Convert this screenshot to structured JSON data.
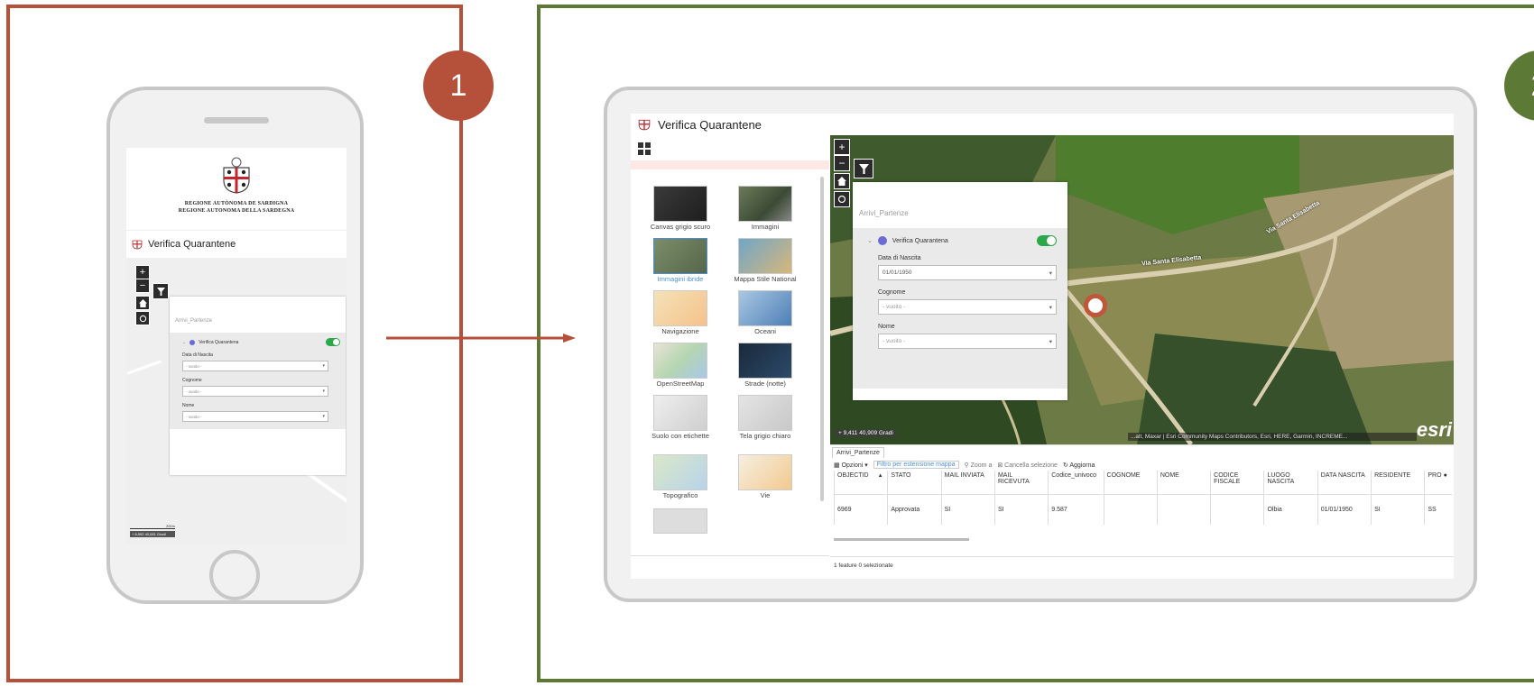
{
  "steps": [
    {
      "number": "1",
      "color": "#b5513a"
    },
    {
      "number": "2",
      "color": "#5c7a36"
    }
  ],
  "mobile": {
    "region_line_1": "REGIONE AUTÒNOMA DE SARDIGNA",
    "region_line_2": "REGIONE AUTONOMA DELLA SARDEGNA",
    "app_title": "Verifica Quarantene",
    "map_controls": {
      "zoom_in": "+",
      "zoom_out": "−"
    },
    "widget": {
      "title": "Arrivi_Partenze",
      "layer_name": "Verifica Quarantena",
      "fields": [
        {
          "label": "Data di Nascita",
          "value": "- vuoito -"
        },
        {
          "label": "Cognome",
          "value": "- vuoito -"
        },
        {
          "label": "Nome",
          "value": "- vuoito -"
        }
      ]
    },
    "scale_label": "200m",
    "coords": "+ 6,992 40,081 Gradi"
  },
  "desktop": {
    "app_title": "Verifica Quarantene",
    "basemaps": [
      {
        "label": "Canvas grigio scuro",
        "icon": "dark-gray-canvas-thumb"
      },
      {
        "label": "Immagini",
        "icon": "imagery-thumb"
      },
      {
        "label": "Immagini ibride",
        "icon": "imagery-hybrid-thumb",
        "selected": true
      },
      {
        "label": "Mappa Stile National",
        "icon": "national-geographic-thumb"
      },
      {
        "label": "Navigazione",
        "icon": "navigation-thumb"
      },
      {
        "label": "Oceani",
        "icon": "oceans-thumb"
      },
      {
        "label": "OpenStreetMap",
        "icon": "osm-thumb"
      },
      {
        "label": "Strade (notte)",
        "icon": "streets-night-thumb"
      },
      {
        "label": "Suolo con etichette",
        "icon": "terrain-thumb"
      },
      {
        "label": "Tela grigio chiaro",
        "icon": "light-gray-canvas-thumb"
      },
      {
        "label": "Topografico",
        "icon": "topographic-thumb"
      },
      {
        "label": "Vie",
        "icon": "streets-thumb"
      }
    ],
    "map_controls": {
      "zoom_in": "+",
      "zoom_out": "−"
    },
    "widget": {
      "title": "Arrivi_Partenze",
      "layer_name": "Verifica Quarantena",
      "fields": [
        {
          "label": "Data di Nascita",
          "value": "01/01/1950"
        },
        {
          "label": "Cognome",
          "value": "- vuoito -"
        },
        {
          "label": "Nome",
          "value": "- vuoito -"
        }
      ]
    },
    "street_label_1": "Via Santa Elisabetta",
    "street_label_2": "Via Santa Elisabetta",
    "coords": "+ 9,411 40,909 Gradi",
    "attribution": "...alt, Maxar | Esri Community Maps Contributors, Esri, HERE, Garmin, INCREME...",
    "esri_logo": "esri",
    "table": {
      "tab_label": "Arrivi_Partenze",
      "toolbar": {
        "options": "Opzioni ▾",
        "filter": "Filtro per estensione mappa",
        "zoom": "Zoom a",
        "clear": "Cancella selezione",
        "refresh": "Aggiorna"
      },
      "columns": [
        "OBJECTID",
        "STATO",
        "MAIL INVIATA",
        "MAIL RICEVUTA",
        "Codice_univoco",
        "COGNOME",
        "NOME",
        "CODICE FISCALE",
        "LUOGO NASCITA",
        "DATA NASCITA",
        "RESIDENTE",
        "PRO"
      ],
      "rows": [
        [
          "6969",
          "Approvata",
          "SI",
          "SI",
          "9.587",
          "",
          "",
          "",
          "Olbia",
          "01/01/1950",
          "SI",
          "SS"
        ]
      ],
      "sort_indicator": "▲",
      "status": "1 feature 0 selezionate"
    }
  }
}
